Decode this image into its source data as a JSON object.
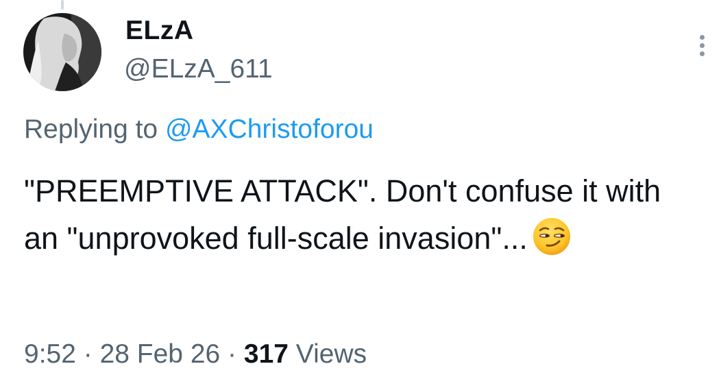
{
  "user": {
    "display_name": "ELzA",
    "handle": "@ELzA_611"
  },
  "reply": {
    "prefix": "Replying to ",
    "mention": "@AXChristoforou"
  },
  "tweet": {
    "text": "\"PREEMPTIVE ATTACK\". Don't confuse it with an \"unprovoked full-scale invasion\"...",
    "emoji": "smirking-face"
  },
  "meta": {
    "time": "9:52",
    "sep1": " · ",
    "date": "28 Feb 26",
    "sep2": " · ",
    "views_count": "317",
    "views_label": " Views"
  },
  "colors": {
    "text": "#0f1419",
    "secondary": "#536471",
    "link": "#1d9bf0"
  }
}
